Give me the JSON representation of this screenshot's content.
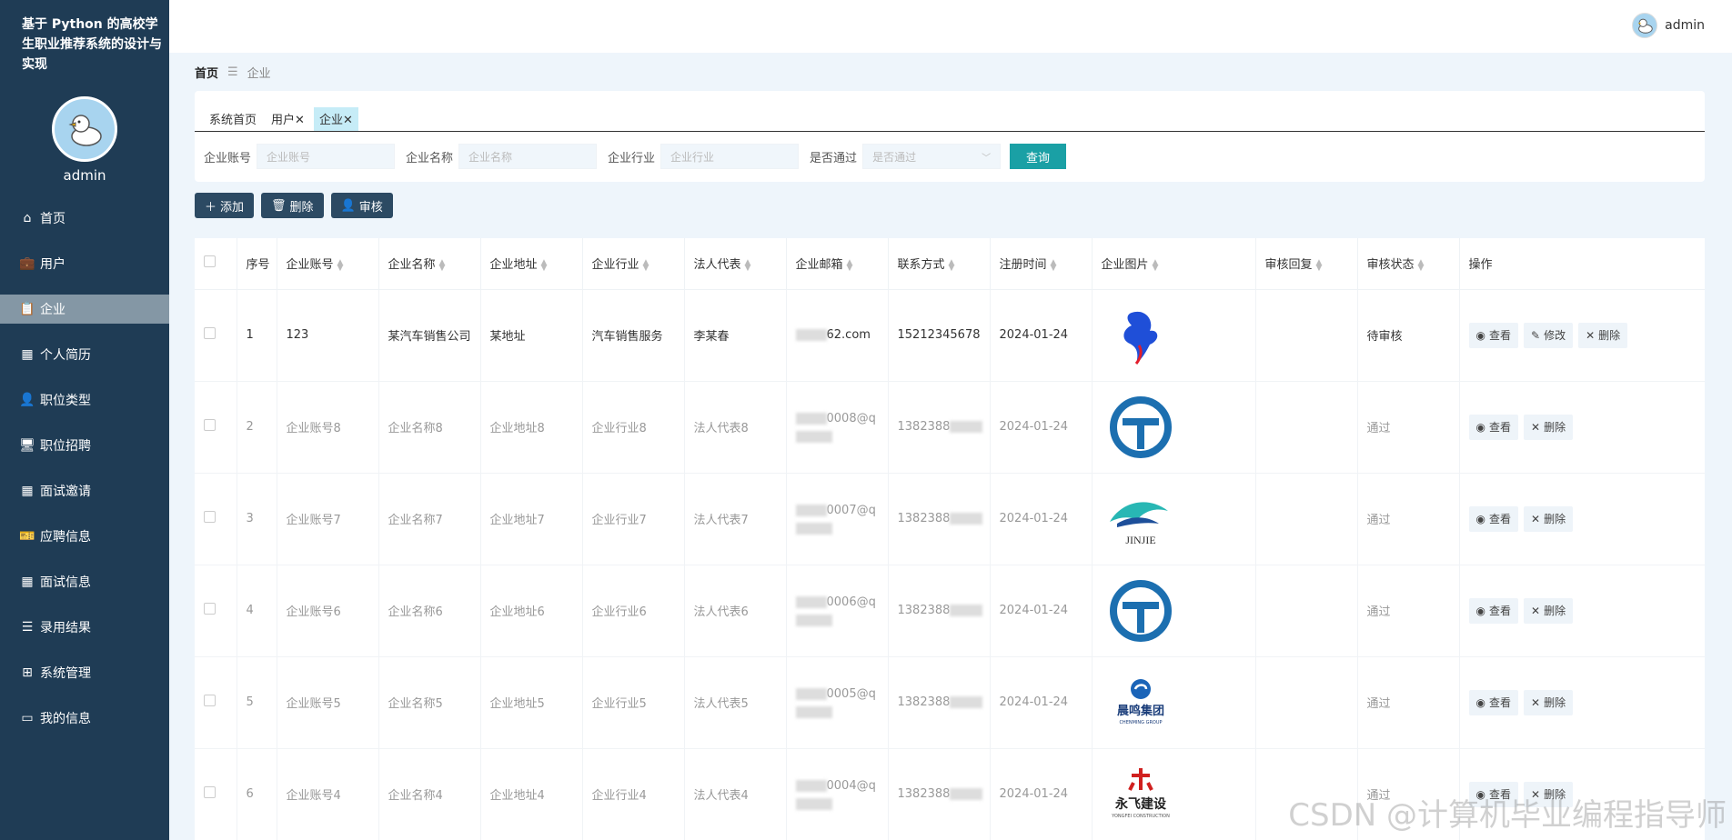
{
  "app": {
    "title": "基于 Python 的高校学生职业推荐系统的设计与实现"
  },
  "sidebar": {
    "username": "admin",
    "items": [
      {
        "label": "首页",
        "icon": "home-icon"
      },
      {
        "label": "用户",
        "icon": "briefcase-icon"
      },
      {
        "label": "企业",
        "icon": "clipboard-icon",
        "active": true
      },
      {
        "label": "个人简历",
        "icon": "grid-icon"
      },
      {
        "label": "职位类型",
        "icon": "user-icon"
      },
      {
        "label": "职位招聘",
        "icon": "monitor-icon"
      },
      {
        "label": "面试邀请",
        "icon": "grid-icon"
      },
      {
        "label": "应聘信息",
        "icon": "ticket-icon"
      },
      {
        "label": "面试信息",
        "icon": "grid-icon"
      },
      {
        "label": "录用结果",
        "icon": "list-icon"
      },
      {
        "label": "系统管理",
        "icon": "apps-icon"
      },
      {
        "label": "我的信息",
        "icon": "card-icon"
      }
    ]
  },
  "header": {
    "username": "admin"
  },
  "breadcrumb": {
    "home": "首页",
    "current": "企业"
  },
  "tabs": [
    {
      "label": "系统首页",
      "closable": false
    },
    {
      "label": "用户",
      "closable": true
    },
    {
      "label": "企业",
      "closable": true,
      "active": true
    }
  ],
  "search": {
    "fields": [
      {
        "label": "企业账号",
        "placeholder": "企业账号"
      },
      {
        "label": "企业名称",
        "placeholder": "企业名称"
      },
      {
        "label": "企业行业",
        "placeholder": "企业行业"
      }
    ],
    "select": {
      "label": "是否通过",
      "placeholder": "是否通过"
    },
    "query_label": "查询"
  },
  "toolbar": {
    "add_label": "添加",
    "delete_label": "删除",
    "audit_label": "审核"
  },
  "table": {
    "columns": [
      "序号",
      "企业账号",
      "企业名称",
      "企业地址",
      "企业行业",
      "法人代表",
      "企业邮箱",
      "联系方式",
      "注册时间",
      "企业图片",
      "审核回复",
      "审核状态",
      "操作"
    ],
    "rows": [
      {
        "no": "1",
        "account": "123",
        "name": "某汽车销售公司",
        "address": "某地址",
        "industry": "汽车销售服务",
        "legal": "李某春",
        "email": "62.com",
        "phone": "15212345678",
        "date": "2024-01-24",
        "logo": "bird-logo",
        "reply": "",
        "status": "待审核",
        "ops": [
          "查看",
          "修改",
          "删除"
        ]
      },
      {
        "no": "2",
        "account": "企业账号8",
        "name": "企业名称8",
        "address": "企业地址8",
        "industry": "企业行业8",
        "legal": "法人代表8",
        "email": "0008@q",
        "phone": "1382388",
        "date": "2024-01-24",
        "logo": "t-circle-logo",
        "reply": "",
        "status": "通过",
        "ops": [
          "查看",
          "删除"
        ]
      },
      {
        "no": "3",
        "account": "企业账号7",
        "name": "企业名称7",
        "address": "企业地址7",
        "industry": "企业行业7",
        "legal": "法人代表7",
        "email": "0007@q",
        "phone": "1382388",
        "date": "2024-01-24",
        "logo": "jinjie-logo",
        "logo_text": "JINJIE",
        "reply": "",
        "status": "通过",
        "ops": [
          "查看",
          "删除"
        ]
      },
      {
        "no": "4",
        "account": "企业账号6",
        "name": "企业名称6",
        "address": "企业地址6",
        "industry": "企业行业6",
        "legal": "法人代表6",
        "email": "0006@q",
        "phone": "1382388",
        "date": "2024-01-24",
        "logo": "t-circle-logo",
        "reply": "",
        "status": "通过",
        "ops": [
          "查看",
          "删除"
        ]
      },
      {
        "no": "5",
        "account": "企业账号5",
        "name": "企业名称5",
        "address": "企业地址5",
        "industry": "企业行业5",
        "legal": "法人代表5",
        "email": "0005@q",
        "phone": "1382388",
        "date": "2024-01-24",
        "logo": "chenming-logo",
        "logo_text": "晨鸣集团",
        "logo_sub": "CHENMING GROUP",
        "reply": "",
        "status": "通过",
        "ops": [
          "查看",
          "删除"
        ]
      },
      {
        "no": "6",
        "account": "企业账号4",
        "name": "企业名称4",
        "address": "企业地址4",
        "industry": "企业行业4",
        "legal": "法人代表4",
        "email": "0004@q",
        "phone": "1382388",
        "date": "2024-01-24",
        "logo": "yongfei-logo",
        "logo_text": "永飞建设",
        "logo_sub": "YONGFEI CONSTRUCTION",
        "reply": "",
        "status": "通过",
        "ops": [
          "查看",
          "删除"
        ]
      }
    ]
  },
  "watermark": "CSDN @计算机毕业编程指导师",
  "colors": {
    "sidebar_bg": "#1f3c55",
    "accent": "#1aa0a5",
    "active_tab": "#c6ecf7"
  }
}
